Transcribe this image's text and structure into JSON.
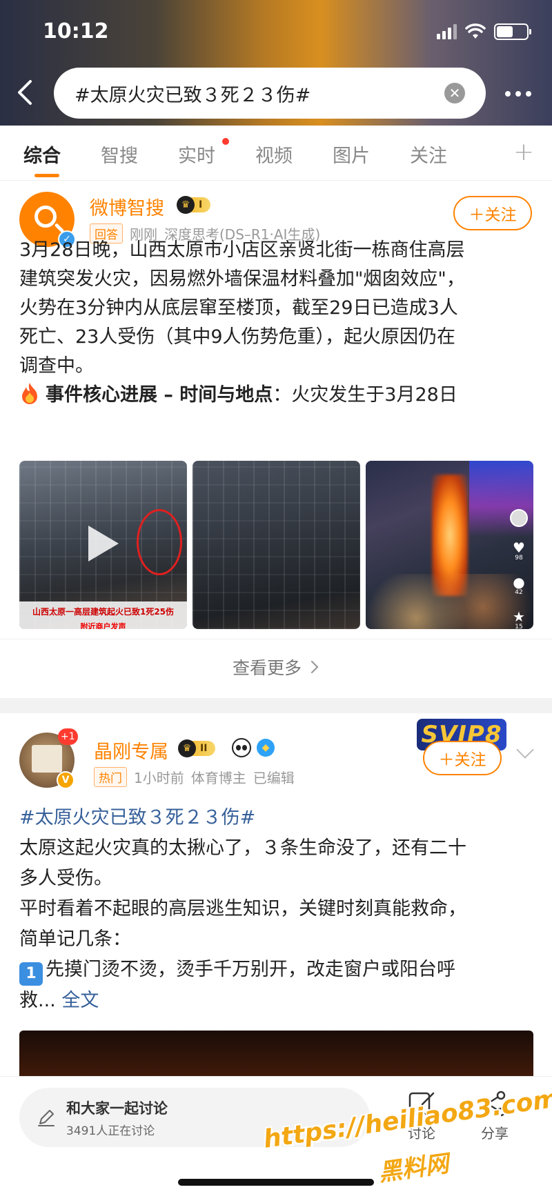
{
  "status_bar": {
    "time": "10:12"
  },
  "search": {
    "query": "#太原火灾已致３死２３伤#"
  },
  "tabs": [
    {
      "label": "综合",
      "active": true
    },
    {
      "label": "智搜"
    },
    {
      "label": "实时",
      "has_dot": true
    },
    {
      "label": "视频"
    },
    {
      "label": "图片"
    },
    {
      "label": "关注"
    }
  ],
  "post1": {
    "user_name": "微博智搜",
    "vip_level": "I",
    "tag": "回答",
    "time": "刚刚",
    "source": "深度思考(DS–R1·AI生成)",
    "follow_label": "＋关注",
    "text_lines": [
      "3月28日晚，山西太原市小店区亲贤北街一栋商住高层",
      "建筑突发火灾，因易燃外墙保温材料叠加\"烟囱效应\"，",
      "火势在3分钟内从底层窜至楼顶，截至29日已造成3人",
      "死亡、23人受伤（其中9人伤势危重），起火原因仍在",
      "调查中。"
    ],
    "progress_heading": "事件核心进展 – 时间与地点",
    "progress_text": "：火灾发生于3月28日",
    "images": [
      {
        "caption": "山西太原一高层建筑起火已致1死25伤",
        "caption_sub": "附近商户发声"
      },
      {
        "caption": ""
      },
      {
        "caption": "",
        "counts": [
          "98",
          "42",
          "15"
        ]
      }
    ],
    "see_more": "查看更多"
  },
  "post2": {
    "user_name": "晶刚专属",
    "vip_level": "II",
    "notif_count": "+1",
    "svip_label": "SVIP8",
    "tag": "热门",
    "time": "1小时前",
    "role": "体育博主",
    "edited": "已编辑",
    "follow_label": "＋关注",
    "hashtag": "#太原火灾已致３死２３伤#",
    "line1": "太原这起火灾真的太揪心了，３条生命没了，还有二十",
    "line2": "多人受伤。",
    "line3": "平时看着不起眼的高层逃生知识，关键时刻真能救命，",
    "line4": "简单记几条：",
    "point_num": "1",
    "point_text": "先摸门烫不烫，烫手千万别开，改走窗户或阳台呼",
    "point_text_2": "救...",
    "full_text_link": "全文"
  },
  "bottom_bar": {
    "discuss_title": "和大家一起讨论",
    "discuss_sub": "3491人正在讨论",
    "comment_label": "讨论",
    "share_label": "分享"
  },
  "watermark": {
    "url": "https://heiliao83.com",
    "name": "黑料网"
  }
}
